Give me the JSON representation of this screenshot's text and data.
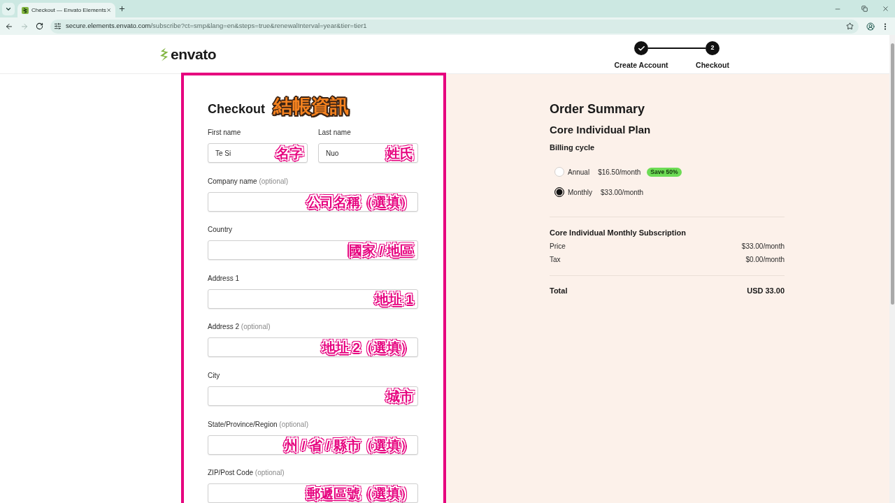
{
  "browser": {
    "tab_title": "Checkout — Envato Elements",
    "url_host": "secure.elements.envato.com",
    "url_path": "/subscribe?ct=smp&lang=en&steps=true&renewalInterval=year&tier=tier1",
    "forward_disabled": true
  },
  "header": {
    "logo": "envato",
    "steps": [
      {
        "label": "Create Account",
        "done": true
      },
      {
        "label": "Checkout",
        "number": "2",
        "done": false
      }
    ]
  },
  "form": {
    "title": "Checkout",
    "title_annotation": "結帳資訊",
    "rows": [
      {
        "fields": [
          {
            "label": "First name",
            "value": "Te Si",
            "annotation": "名字"
          },
          {
            "label": "Last name",
            "value": "Nuo",
            "annotation": "姓氏"
          }
        ]
      },
      {
        "fields": [
          {
            "label": "Company name",
            "note": "(optional)",
            "annotation": "公司名稱（選填）"
          }
        ]
      },
      {
        "fields": [
          {
            "label": "Country",
            "annotation": "國家 / 地區"
          }
        ]
      },
      {
        "fields": [
          {
            "label": "Address 1",
            "annotation": "地址 1"
          }
        ]
      },
      {
        "fields": [
          {
            "label": "Address 2",
            "note": "(optional)",
            "annotation": "地址 2（選填）"
          }
        ]
      },
      {
        "fields": [
          {
            "label": "City",
            "annotation": "城市"
          }
        ]
      },
      {
        "fields": [
          {
            "label": "State/Province/Region",
            "note": "(optional)",
            "annotation": "州 / 省 / 縣市（選填）"
          }
        ]
      },
      {
        "fields": [
          {
            "label": "ZIP/Post Code",
            "note": "(optional)",
            "annotation": "郵遞區號（選填）"
          }
        ]
      }
    ]
  },
  "summary": {
    "title": "Order Summary",
    "plan": "Core Individual Plan",
    "billing_heading": "Billing cycle",
    "billing_options": [
      {
        "label": "Annual",
        "price": "$16.50/month",
        "badge": "Save 50%",
        "selected": false
      },
      {
        "label": "Monthly",
        "price": "$33.00/month",
        "selected": true
      }
    ],
    "subscription": "Core Individual Monthly Subscription",
    "lines": [
      {
        "label": "Price",
        "value": "$33.00/month"
      },
      {
        "label": "Tax",
        "value": "$0.00/month"
      }
    ],
    "total": {
      "label": "Total",
      "value": "USD 33.00"
    }
  }
}
